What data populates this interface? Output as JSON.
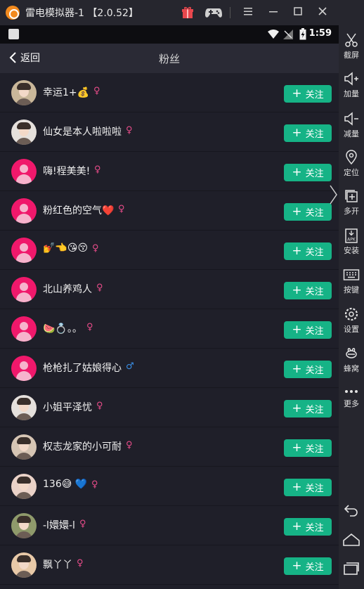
{
  "window": {
    "title": "雷电模拟器-1 【2.0.52】",
    "controls": [
      "gift-icon",
      "gamepad-icon",
      "menu-icon",
      "minimize-icon",
      "maximize-icon",
      "close-icon",
      "collapse-sidebar-icon"
    ]
  },
  "status_bar": {
    "time": "1:59"
  },
  "header": {
    "back_label": "返回",
    "title": "粉丝"
  },
  "follow_label": "关注",
  "colors": {
    "accent": "#16b386",
    "female": "#e84c8a",
    "male": "#3a8ee6",
    "avatar_default": "#f0186b"
  },
  "rows": [
    {
      "name": "幸运1+💰",
      "gender": "♀",
      "avatar": "photo"
    },
    {
      "name": "仙女是本人啦啦啦",
      "gender": "♀",
      "avatar": "photo"
    },
    {
      "name": "嗨!程美美!",
      "gender": "♀",
      "avatar": "default"
    },
    {
      "name": "粉红色的空气❤️",
      "gender": "♀",
      "avatar": "default"
    },
    {
      "name": "💅👈😘😚",
      "gender": "♀",
      "avatar": "default"
    },
    {
      "name": "北山养鸡人",
      "gender": "♀",
      "avatar": "default"
    },
    {
      "name": "🍉💍。。",
      "gender": "♀",
      "avatar": "default"
    },
    {
      "name": "枪枪扎了姑娘得心",
      "gender": "♂",
      "avatar": "default"
    },
    {
      "name": "小姐平泽忧",
      "gender": "♀",
      "avatar": "photo"
    },
    {
      "name": "权志龙家的小可耐",
      "gender": "♀",
      "avatar": "photo"
    },
    {
      "name": "136😅 💙",
      "gender": "♀",
      "avatar": "photo"
    },
    {
      "name": "-l嬛嬛-l",
      "gender": "♀",
      "avatar": "photo"
    },
    {
      "name": "飘丫丫",
      "gender": "♀",
      "avatar": "photo"
    }
  ],
  "sidebar": {
    "items": [
      {
        "label": "截屏",
        "icon": "scissors-icon"
      },
      {
        "label": "加量",
        "icon": "volume-up-icon"
      },
      {
        "label": "减量",
        "icon": "volume-down-icon"
      },
      {
        "label": "定位",
        "icon": "location-icon"
      },
      {
        "label": "多开",
        "icon": "multi-instance-icon"
      },
      {
        "label": "安装",
        "icon": "apk-install-icon"
      },
      {
        "label": "按键",
        "icon": "keyboard-icon"
      },
      {
        "label": "设置",
        "icon": "gear-icon"
      },
      {
        "label": "蜂窝",
        "icon": "hive-icon"
      },
      {
        "label": "更多",
        "icon": "more-icon"
      }
    ],
    "nav": [
      "back-icon",
      "home-icon",
      "recents-icon"
    ]
  }
}
